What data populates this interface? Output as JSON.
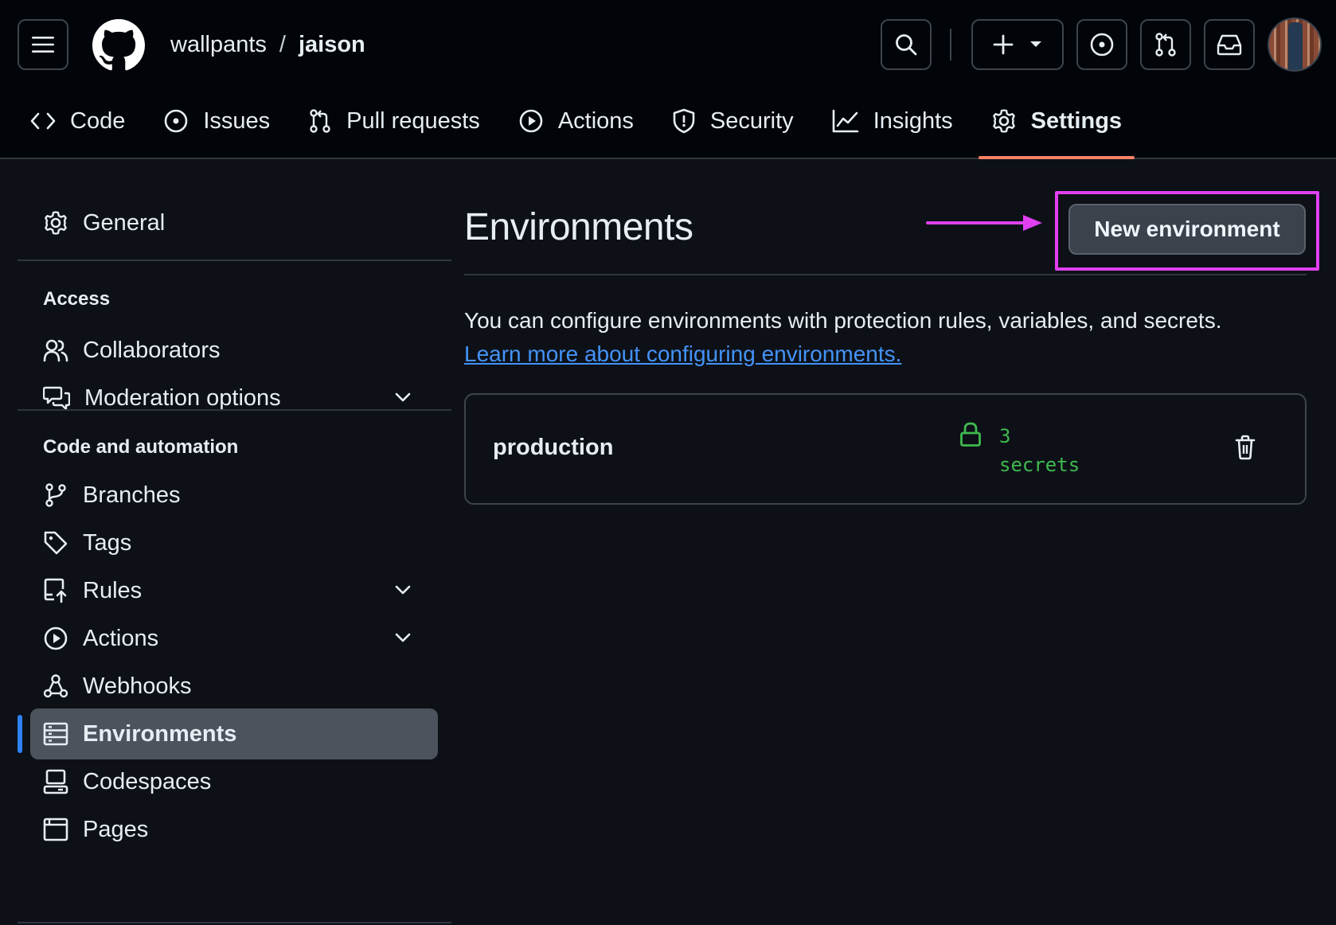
{
  "header": {
    "owner": "wallpants",
    "separator": "/",
    "repo": "jaison"
  },
  "tabs": [
    {
      "label": "Code",
      "icon": "code-icon"
    },
    {
      "label": "Issues",
      "icon": "issue-opened-icon"
    },
    {
      "label": "Pull requests",
      "icon": "git-pull-request-icon"
    },
    {
      "label": "Actions",
      "icon": "play-icon"
    },
    {
      "label": "Security",
      "icon": "shield-icon"
    },
    {
      "label": "Insights",
      "icon": "graph-icon"
    },
    {
      "label": "Settings",
      "icon": "gear-icon",
      "active": true
    }
  ],
  "sidebar": {
    "general": "General",
    "access_heading": "Access",
    "access_items": [
      {
        "label": "Collaborators",
        "icon": "people-icon"
      },
      {
        "label": "Moderation options",
        "icon": "comment-discussion-icon",
        "expandable": true
      }
    ],
    "code_heading": "Code and automation",
    "code_items": [
      {
        "label": "Branches",
        "icon": "git-branch-icon"
      },
      {
        "label": "Tags",
        "icon": "tag-icon"
      },
      {
        "label": "Rules",
        "icon": "repo-push-icon",
        "expandable": true
      },
      {
        "label": "Actions",
        "icon": "play-icon",
        "expandable": true
      },
      {
        "label": "Webhooks",
        "icon": "webhook-icon"
      },
      {
        "label": "Environments",
        "icon": "server-icon",
        "active": true
      },
      {
        "label": "Codespaces",
        "icon": "codespaces-icon"
      },
      {
        "label": "Pages",
        "icon": "browser-icon"
      }
    ]
  },
  "main": {
    "title": "Environments",
    "new_button": "New environment",
    "description": "You can configure environments with protection rules, variables, and secrets.",
    "learn_more": "Learn more about configuring environments.",
    "environments": [
      {
        "name": "production",
        "secrets_count": "3",
        "secrets_label": "secrets"
      }
    ]
  },
  "colors": {
    "background": "#0d1117",
    "header_bg": "#010409",
    "active_tab_underline": "#f78166",
    "link": "#4493f8",
    "secrets_green": "#3fb950",
    "annotation_magenta": "#e040f0",
    "active_sidebar_bar": "#2f81f7"
  }
}
